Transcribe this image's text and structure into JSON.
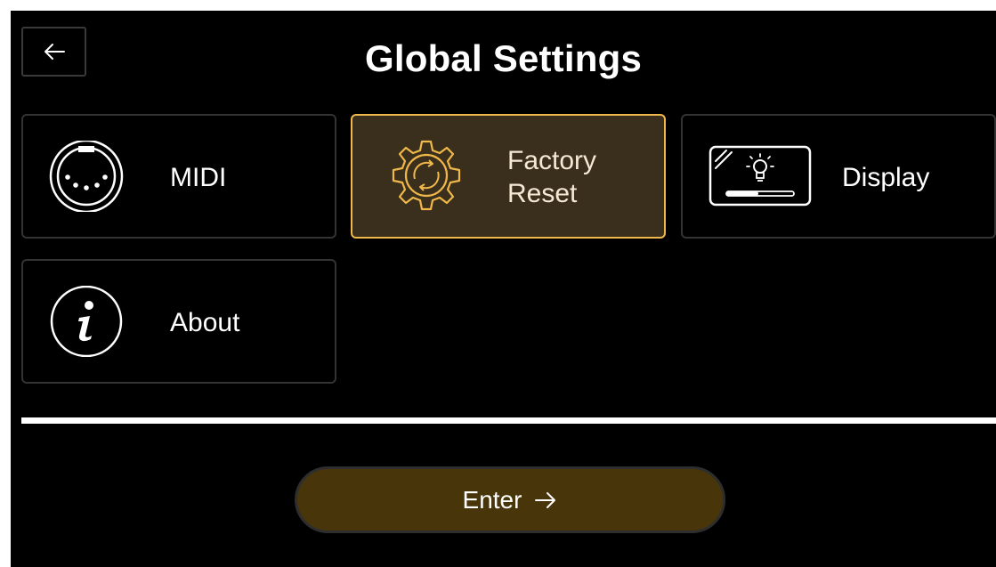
{
  "header": {
    "title": "Global Settings",
    "back_icon": "arrow-left-icon"
  },
  "tiles": [
    {
      "label": "MIDI",
      "icon": "midi-connector-icon",
      "selected": false
    },
    {
      "label": "Factory\nReset",
      "icon": "gear-reset-icon",
      "selected": true
    },
    {
      "label": "Display",
      "icon": "display-brightness-icon",
      "selected": false
    },
    {
      "label": "About",
      "icon": "info-icon",
      "selected": false
    }
  ],
  "footer": {
    "enter_label": "Enter",
    "enter_icon": "arrow-right-icon"
  },
  "colors": {
    "background": "#000000",
    "accent": "#f0b84a",
    "selected_fill": "#3a2f1c",
    "enter_fill": "#48350a"
  }
}
